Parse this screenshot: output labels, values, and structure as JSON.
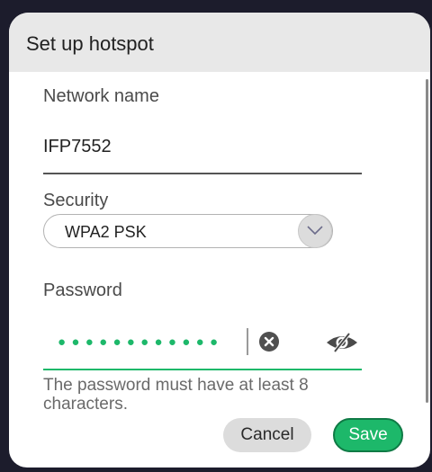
{
  "dialog": {
    "title": "Set up hotspot"
  },
  "network": {
    "label": "Network name",
    "value": "IFP7552"
  },
  "security": {
    "label": "Security",
    "selected": "WPA2 PSK"
  },
  "password": {
    "label": "Password",
    "masked_value": "●●●●●●●●●●●●",
    "helper": "The password must have at least 8 characters."
  },
  "buttons": {
    "cancel": "Cancel",
    "save": "Save"
  },
  "icons": {
    "dropdown": "chevron-down-icon",
    "clear": "clear-icon",
    "visibility": "visibility-off-icon"
  },
  "colors": {
    "accent": "#1db86a",
    "header_bg": "#e8e8e8"
  }
}
